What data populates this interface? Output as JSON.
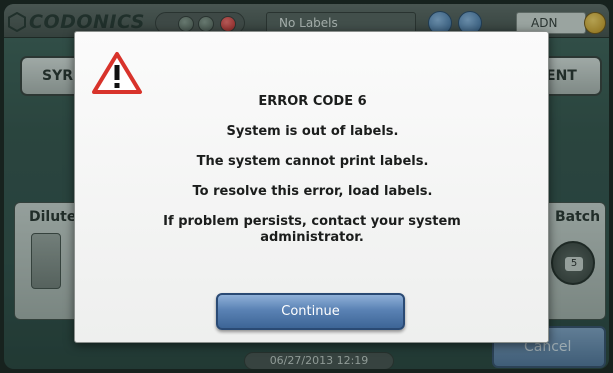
{
  "app": {
    "logo_text": "CODONICS"
  },
  "topbar": {
    "status_label": "No Labels",
    "user": "ADN"
  },
  "background": {
    "left_button": "SYR",
    "right_button": "ENT",
    "left_panel_title": "Dilute",
    "right_panel_title": "Batch",
    "batch_count": "5",
    "cancel_label": "Cancel",
    "datetime": "06/27/2013 12:19"
  },
  "dialog": {
    "code": "ERROR CODE 6",
    "line1": "System is out of labels.",
    "line2": "The system cannot print labels.",
    "line3": "To resolve this error, load labels.",
    "line4": "If problem persists, contact your system administrator.",
    "continue_label": "Continue"
  },
  "colors": {
    "accent_blue": "#5a82b4",
    "warning_red": "#d8332b",
    "indicator_red": "#c01818"
  },
  "icons": {
    "warning": "warning-triangle-icon",
    "help": "help-icon",
    "power": "power-icon"
  }
}
